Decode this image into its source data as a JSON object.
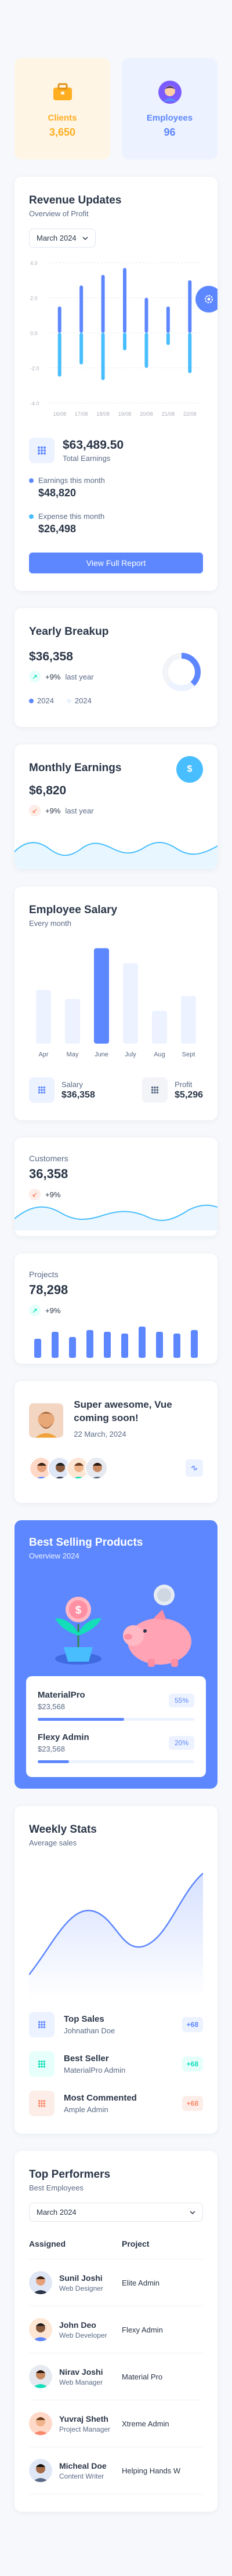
{
  "stats": {
    "clients": {
      "label": "Clients",
      "value": "3,650"
    },
    "employees": {
      "label": "Employees",
      "value": "96"
    }
  },
  "revenue": {
    "title": "Revenue Updates",
    "subtitle": "Overview of Profit",
    "period": "March 2024",
    "total_value": "$63,489.50",
    "total_label": "Total Earnings",
    "earnings_label": "Earnings this month",
    "earnings_value": "$48,820",
    "expense_label": "Expense this month",
    "expense_value": "$26,498",
    "button": "View Full Report"
  },
  "chart_data": {
    "type": "bar",
    "categories": [
      "16/08",
      "17/08",
      "18/08",
      "19/08",
      "20/08",
      "21/08",
      "22/08"
    ],
    "yticks": [
      "4.0",
      "2.0",
      "0.0",
      "-2.0",
      "-4.0"
    ],
    "ylim": [
      -4,
      4
    ],
    "series": [
      {
        "values": [
          1.5,
          2.7,
          3.3,
          3.7,
          2.0,
          1.5,
          3.0
        ]
      },
      {
        "values": [
          -2.5,
          -1.8,
          -2.7,
          -1.0,
          -2.0,
          -0.7,
          -2.3
        ]
      }
    ],
    "colors": [
      "#5d87ff",
      "#49beff"
    ]
  },
  "yearly": {
    "title": "Yearly Breakup",
    "value": "$36,358",
    "change": "+9%",
    "change_label": "last year",
    "legend": [
      "2024",
      "2024"
    ],
    "donut": {
      "primary": 0.38,
      "secondary": 0.25
    }
  },
  "monthly": {
    "title": "Monthly Earnings",
    "value": "$6,820",
    "change": "+9%",
    "change_label": "last year",
    "icon": "dollar-icon"
  },
  "salary": {
    "title": "Employee Salary",
    "subtitle": "Every month",
    "months": [
      "Apr",
      "May",
      "June",
      "July",
      "Aug",
      "Sept"
    ],
    "values": [
      18,
      15,
      32,
      27,
      11,
      16
    ],
    "highlight_index": 2,
    "salary_label": "Salary",
    "salary_value": "$36,358",
    "profit_label": "Profit",
    "profit_value": "$5,296"
  },
  "customers": {
    "title": "Customers",
    "value": "36,358",
    "change": "+9%"
  },
  "projects": {
    "title": "Projects",
    "value": "78,298",
    "change": "+9%",
    "bars": [
      0.55,
      0.75,
      0.6,
      0.8,
      0.75,
      0.7,
      0.9,
      0.75,
      0.7,
      0.8
    ]
  },
  "vue": {
    "title": "Super awesome, Vue coming soon!",
    "date": "22 March, 2024"
  },
  "best_selling": {
    "title": "Best Selling Products",
    "subtitle": "Overview 2024",
    "products": [
      {
        "name": "MaterialPro",
        "price": "$23,568",
        "percent": "55%",
        "fill": 0.55
      },
      {
        "name": "Flexy Admin",
        "price": "$23,568",
        "percent": "20%",
        "fill": 0.2
      }
    ]
  },
  "weekly": {
    "title": "Weekly Stats",
    "subtitle": "Average sales",
    "items": [
      {
        "title": "Top Sales",
        "sub": "Johnathan Doe",
        "badge": "+68",
        "color": "#5d87ff",
        "bg": "#ecf2ff"
      },
      {
        "title": "Best Seller",
        "sub": "MaterialPro Admin",
        "badge": "+68",
        "color": "#13deb9",
        "bg": "#e6fffa"
      },
      {
        "title": "Most Commented",
        "sub": "Ample Admin",
        "badge": "+68",
        "color": "#fa896b",
        "bg": "#fdede8"
      }
    ]
  },
  "performers": {
    "title": "Top Performers",
    "subtitle": "Best Employees",
    "period": "March 2024",
    "col_assigned": "Assigned",
    "col_project": "Project",
    "rows": [
      {
        "name": "Sunil Joshi",
        "role": "Web Designer",
        "project": "Elite Admin"
      },
      {
        "name": "John Deo",
        "role": "Web Developer",
        "project": "Flexy Admin"
      },
      {
        "name": "Nirav Joshi",
        "role": "Web Manager",
        "project": "Material Pro"
      },
      {
        "name": "Yuvraj Sheth",
        "role": "Project Manager",
        "project": "Xtreme Admin"
      },
      {
        "name": "Micheal Doe",
        "role": "Content Writer",
        "project": "Helping Hands W"
      }
    ]
  }
}
